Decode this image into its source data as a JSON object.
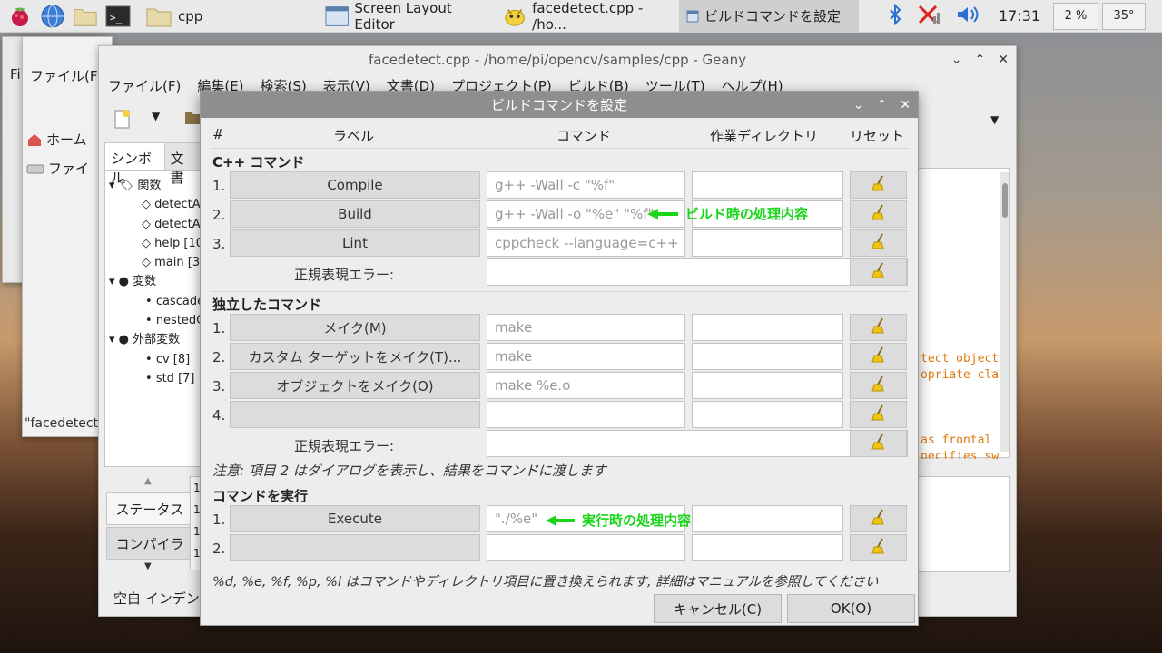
{
  "taskbar": {
    "folder_task": "cpp",
    "screen_layout_task": "Screen Layout Editor",
    "geany_task": "facedetect.cpp - /ho...",
    "dialog_task": "ビルドコマンドを設定",
    "clock": "17:31",
    "cpu": "2 %",
    "temp": "35°"
  },
  "bg_window": {
    "label_fi": "Fi",
    "menu_file": "ファイル(F",
    "home": "ホーム",
    "files": "ファイ",
    "status_file": "\"facedetect."
  },
  "geany": {
    "title": "facedetect.cpp - /home/pi/opencv/samples/cpp - Geany",
    "menus": [
      "ファイル(F)",
      "編集(E)",
      "検索(S)",
      "表示(V)",
      "文書(D)",
      "プロジェクト(P)",
      "ビルド(B)",
      "ツール(T)",
      "ヘルプ(H)"
    ],
    "sidebar_tabs": [
      "シンボル",
      "文書"
    ],
    "tree": {
      "functions": "関数",
      "fn_items": [
        "detectA",
        "detectA",
        "help [10",
        "main [3"
      ],
      "variables": "変数",
      "var_items": [
        "cascade",
        "nestedC"
      ],
      "externals": "外部変数",
      "ext_items": [
        "cv [8]",
        "std [7]"
      ]
    },
    "msg_tabs": [
      "ステータス",
      "コンパイラ"
    ],
    "statusbar": "空白 インデン",
    "code_lines": [
      "tect object",
      "opriate cla",
      "as frontal",
      "pecifies sw"
    ],
    "msg_lines": [
      "1",
      "1",
      "1",
      "1"
    ]
  },
  "dialog": {
    "title": "ビルドコマンドを設定",
    "headers": {
      "num": "#",
      "label": "ラベル",
      "command": "コマンド",
      "workdir": "作業ディレクトリ",
      "reset": "リセット"
    },
    "cpp_section": "C++ コマンド",
    "cpp_rows": [
      {
        "num": "1.",
        "label": "Compile",
        "command": "g++ -Wall -c \"%f\""
      },
      {
        "num": "2.",
        "label": "Build",
        "command": "g++ -Wall -o \"%e\" \"%f\""
      },
      {
        "num": "3.",
        "label": "Lint",
        "command": "cppcheck --language=c++ --e"
      }
    ],
    "regex_label": "正規表現エラー:",
    "indep_section": "独立したコマンド",
    "indep_rows": [
      {
        "num": "1.",
        "label": "メイク(M)",
        "command": "make"
      },
      {
        "num": "2.",
        "label": "カスタム ターゲットをメイク(T)...",
        "command": "make"
      },
      {
        "num": "3.",
        "label": "オブジェクトをメイク(O)",
        "command": "make %e.o"
      },
      {
        "num": "4.",
        "label": "",
        "command": ""
      }
    ],
    "note": "注意: 項目 2 はダイアログを表示し、結果をコマンドに渡します",
    "exec_section": "コマンドを実行",
    "exec_rows": [
      {
        "num": "1.",
        "label": "Execute",
        "command": "\"./%e\""
      },
      {
        "num": "2.",
        "label": "",
        "command": ""
      }
    ],
    "footer": "%d, %e, %f, %p, %l はコマンドやディレクトリ項目に置き換えられます, 詳細はマニュアルを参照してください",
    "cancel": "キャンセル(C)",
    "ok": "OK(O)",
    "annotation_build": "ビルド時の処理内容",
    "annotation_exec": "実行時の処理内容"
  }
}
